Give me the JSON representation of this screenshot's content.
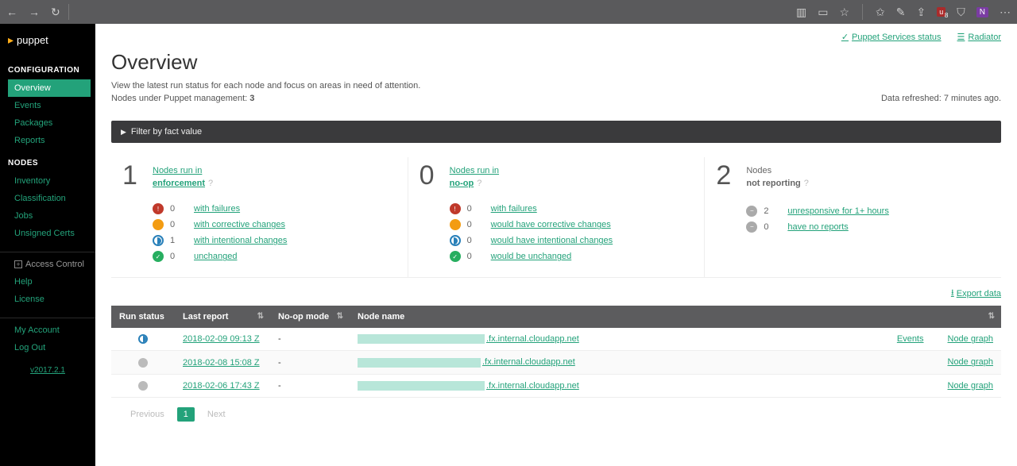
{
  "chrome": {
    "url_redacted": ""
  },
  "brand": "puppet",
  "sidebar": {
    "section_config": "CONFIGURATION",
    "config_items": [
      {
        "label": "Overview",
        "active": true
      },
      {
        "label": "Events",
        "active": false
      },
      {
        "label": "Packages",
        "active": false
      },
      {
        "label": "Reports",
        "active": false
      }
    ],
    "section_nodes": "NODES",
    "nodes_items": [
      {
        "label": "Inventory"
      },
      {
        "label": "Classification"
      },
      {
        "label": "Jobs"
      },
      {
        "label": "Unsigned Certs"
      }
    ],
    "access_control": "Access Control",
    "help": "Help",
    "license": "License",
    "my_account": "My Account",
    "log_out": "Log Out",
    "version": "v2017.2.1"
  },
  "top_links": {
    "services": "Puppet Services status",
    "radiator": "Radiator"
  },
  "page": {
    "title": "Overview",
    "subtitle": "View the latest run status for each node and focus on areas in need of attention.",
    "nodes_mgmt_label": "Nodes under Puppet management: ",
    "nodes_mgmt_count": "3",
    "refreshed": "Data refreshed: 7 minutes ago."
  },
  "filter_bar": "Filter by fact value",
  "stats": [
    {
      "count": "1",
      "line1": "Nodes run in",
      "line2": "enforcement",
      "line2_class": "stat-sub",
      "items": [
        {
          "iconClass": "i-red",
          "glyph": "!",
          "count": "0",
          "label": "with failures"
        },
        {
          "iconClass": "i-orange",
          "glyph": "",
          "count": "0",
          "label": "with corrective changes"
        },
        {
          "iconClass": "i-blue",
          "glyph": "",
          "count": "1",
          "label": "with intentional changes"
        },
        {
          "iconClass": "i-green",
          "glyph": "✓",
          "count": "0",
          "label": "unchanged"
        }
      ]
    },
    {
      "count": "0",
      "line1": "Nodes run in",
      "line2": "no-op",
      "line2_class": "stat-sub",
      "items": [
        {
          "iconClass": "i-red",
          "glyph": "!",
          "count": "0",
          "label": "with failures"
        },
        {
          "iconClass": "i-orange",
          "glyph": "",
          "count": "0",
          "label": "would have corrective changes"
        },
        {
          "iconClass": "i-blue",
          "glyph": "",
          "count": "0",
          "label": "would have intentional changes"
        },
        {
          "iconClass": "i-green",
          "glyph": "✓",
          "count": "0",
          "label": "would be unchanged"
        }
      ]
    },
    {
      "count": "2",
      "line1_gray": "Nodes",
      "line2_gray": "not reporting",
      "items": [
        {
          "iconClass": "i-gray",
          "glyph": "−",
          "count": "2",
          "label": "unresponsive for 1+ hours"
        },
        {
          "iconClass": "i-gray",
          "glyph": "−",
          "count": "0",
          "label": "have no reports"
        }
      ]
    }
  ],
  "export": "Export data",
  "table": {
    "headers": {
      "run_status": "Run status",
      "last_report": "Last report",
      "noop": "No-op mode",
      "node_name": "Node name"
    },
    "rows": [
      {
        "status_class": "rsi-blue",
        "last_report": "2018-02-09 09:13 Z",
        "noop": "-",
        "node_bar_w": "160",
        "node_suffix": ".fx.internal.cloudapp.net",
        "events": "Events",
        "graph": "Node graph"
      },
      {
        "status_class": "rsi-gray",
        "last_report": "2018-02-08 15:08 Z",
        "noop": "-",
        "node_bar_w": "155",
        "node_suffix": ".fx.internal.cloudapp.net",
        "events": "",
        "graph": "Node graph"
      },
      {
        "status_class": "rsi-gray",
        "last_report": "2018-02-06 17:43 Z",
        "noop": "-",
        "node_bar_w": "160",
        "node_suffix": ".fx.internal.cloudapp.net",
        "events": "",
        "graph": "Node graph"
      }
    ]
  },
  "pager": {
    "prev": "Previous",
    "current": "1",
    "next": "Next"
  }
}
